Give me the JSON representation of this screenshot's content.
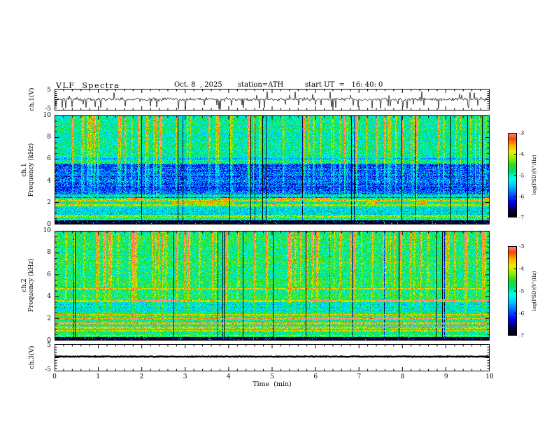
{
  "header": {
    "title": "VLF  Spectra",
    "date": "Oct. 8  , 2025",
    "station": "station=ATH",
    "start_ut": "start UT  =   16: 40: 0"
  },
  "xaxis": {
    "label": "Time  (min)",
    "ticks": [
      "0",
      "1",
      "2",
      "3",
      "4",
      "5",
      "6",
      "7",
      "8",
      "9",
      "10"
    ],
    "range": [
      0,
      10
    ]
  },
  "panels": {
    "ch1_wave": {
      "ylabel": "ch.1(V)",
      "ytick_top": "5",
      "ytick_bottom": "-5",
      "ylim": [
        -5,
        5
      ]
    },
    "ch1_spec": {
      "ylabel_ch": "ch.1",
      "ylabel_freq": "Frequency  (kHz)",
      "yticks": [
        "10",
        "8",
        "6",
        "4",
        "2",
        "0"
      ],
      "ylim": [
        0,
        10
      ]
    },
    "ch2_spec": {
      "ylabel_ch": "ch.2",
      "ylabel_freq": "Frequency  (kHz)",
      "yticks": [
        "10",
        "8",
        "6",
        "4",
        "2",
        "0"
      ],
      "ylim": [
        0,
        10
      ]
    },
    "ch3_wave": {
      "ylabel": "ch.3(V)",
      "ytick_top": "5",
      "ytick_bottom": "-5",
      "ylim": [
        -5,
        5
      ]
    }
  },
  "colorbar": {
    "label": "log(PSD)(V²/Hz)",
    "ticks": [
      "-3",
      "-4",
      "-5",
      "-6",
      "-7"
    ],
    "range": [
      -7,
      -3
    ]
  },
  "colors": {
    "background": "#ffffff",
    "trace": "#000000",
    "colormap_stops": [
      [
        0.0,
        "#000000"
      ],
      [
        0.1,
        "#02025e"
      ],
      [
        0.18,
        "#0000ff"
      ],
      [
        0.28,
        "#0066ff"
      ],
      [
        0.38,
        "#00ccff"
      ],
      [
        0.46,
        "#00ffee"
      ],
      [
        0.54,
        "#00e070"
      ],
      [
        0.62,
        "#22dd22"
      ],
      [
        0.7,
        "#99ee00"
      ],
      [
        0.78,
        "#eeee00"
      ],
      [
        0.86,
        "#ffaa00"
      ],
      [
        0.93,
        "#ff4400"
      ],
      [
        1.0,
        "#ff8888"
      ]
    ]
  },
  "chart_data": [
    {
      "type": "line",
      "title": "ch.1 voltage waveform",
      "xlabel": "Time (min)",
      "xlim": [
        0,
        10
      ],
      "ylabel": "ch.1(V)",
      "ylim": [
        -5,
        5
      ],
      "description": "Dense noise trace centered near 0 V (±1 V fuzz) with frequent impulsive downward spikes reaching -3 to -5 V and occasional upward spikes to +2/+4 V across the full 10 minutes.",
      "render": {
        "seed": 99,
        "sd": 0.5,
        "spike_down_prob": 0.07,
        "spike_up_prob": 0.02,
        "lw": 0.7
      }
    },
    {
      "type": "heatmap",
      "title": "ch.1 VLF spectrogram",
      "xlabel": "Time (min)",
      "xlim": [
        0,
        10
      ],
      "ylabel": "ch.1 Frequency (kHz)",
      "ylim": [
        0,
        10
      ],
      "value_label": "log(PSD)(V²/Hz)",
      "value_range": [
        -7,
        -3
      ],
      "features": [
        "green/cyan broadband background",
        "dense vertical yellow-to-red impulsive streaks (sferics), strongest above ~5 kHz",
        "quiet dark-blue speckled band between ~2.8 and 5.6 kHz",
        "bright narrowband horizontal lines near 0.45, 0.72, 1.72 and 2.18 kHz",
        "intermittent red dash segments near 1.95 and 2.33 kHz",
        "black band below ~0.35 kHz",
        "occasional thin dark vertical dropout lines"
      ],
      "render": {
        "seed": 12345,
        "fmax": 10,
        "base": 0.5,
        "noise": 0.13,
        "row_noise": 0.05,
        "streak_prob": 0.1,
        "streak_decay": 0.5,
        "streak_gain": 0.55,
        "streak_f0": 1.2,
        "dark_prob": 0.02,
        "quiet": [
          2.75,
          5.6,
          0.24
        ],
        "black_f": 0.35,
        "lines": [
          {
            "f": 2.18,
            "w": 0.1,
            "d": 0.3
          },
          {
            "f": 1.72,
            "w": 0.09,
            "d": 0.26
          },
          {
            "f": 0.72,
            "w": 0.08,
            "d": 0.22
          },
          {
            "f": 0.45,
            "w": 0.05,
            "d": 0.18
          },
          {
            "f": 1.2,
            "w": 0.3,
            "d": -0.1
          },
          {
            "f": 2.5,
            "w": 0.05,
            "d": -0.18
          },
          {
            "f": 6.05,
            "w": 0.05,
            "d": -0.15
          }
        ],
        "dashes": [
          {
            "f": 2.33,
            "w": 0.1,
            "d": 0.38,
            "pon": 0.012,
            "poff": 0.02
          },
          {
            "f": 1.95,
            "w": 0.07,
            "d": 0.3,
            "pon": 0.01,
            "poff": 0.03
          }
        ]
      }
    },
    {
      "type": "heatmap",
      "title": "ch.2 VLF spectrogram",
      "xlabel": "Time (min)",
      "xlim": [
        0,
        10
      ],
      "ylabel": "ch.2 Frequency (kHz)",
      "ylim": [
        0,
        10
      ],
      "value_label": "log(PSD)(V²/Hz)",
      "value_range": [
        -7,
        -3
      ],
      "features": [
        "green/yellow broadband background, brighter than ch.1",
        "vertical impulsive streaks spanning ~1-10 kHz",
        "bright horizontal hum lines near 0.45, 0.85, 1.15, 1.55, 1.95, 2.35 and 3.6 kHz",
        "thin line near 4.7 kHz",
        "mild bluer band between ~2.6 and 3.5 kHz",
        "intermittent red dash segments near 1.2, 2.0 and 3.62 kHz",
        "black band below ~0.3 kHz"
      ],
      "render": {
        "seed": 777,
        "fmax": 10,
        "base": 0.55,
        "noise": 0.13,
        "row_noise": 0.05,
        "streak_prob": 0.12,
        "streak_decay": 0.5,
        "streak_gain": 0.5,
        "streak_f0": 0.8,
        "dark_prob": 0.025,
        "quiet": [
          2.6,
          3.5,
          0.1
        ],
        "black_f": 0.3,
        "lines": [
          {
            "f": 2.35,
            "w": 0.08,
            "d": 0.26
          },
          {
            "f": 1.95,
            "w": 0.08,
            "d": 0.3
          },
          {
            "f": 1.55,
            "w": 0.08,
            "d": 0.28
          },
          {
            "f": 1.15,
            "w": 0.07,
            "d": 0.24
          },
          {
            "f": 0.85,
            "w": 0.06,
            "d": 0.22
          },
          {
            "f": 3.6,
            "w": 0.08,
            "d": 0.2
          },
          {
            "f": 4.7,
            "w": 0.05,
            "d": 0.18
          },
          {
            "f": 0.45,
            "w": 0.05,
            "d": 0.18
          }
        ],
        "dashes": [
          {
            "f": 3.62,
            "w": 0.1,
            "d": 0.34,
            "pon": 0.012,
            "poff": 0.025
          },
          {
            "f": 2.0,
            "w": 0.09,
            "d": 0.3,
            "pon": 0.01,
            "poff": 0.03
          },
          {
            "f": 1.2,
            "w": 0.08,
            "d": 0.28,
            "pon": 0.01,
            "poff": 0.03
          }
        ]
      }
    },
    {
      "type": "line",
      "title": "ch.3 voltage waveform",
      "xlabel": "Time (min)",
      "xlim": [
        0,
        10
      ],
      "ylabel": "ch.3(V)",
      "ylim": [
        -5,
        5
      ],
      "description": "Essentially flat thick black trace just above 0 V for the whole interval (no signal on channel 3).",
      "render": {
        "seed": 5,
        "flat": true,
        "level": 0.3,
        "jitter": 0.25,
        "lw": 2.4
      }
    }
  ]
}
